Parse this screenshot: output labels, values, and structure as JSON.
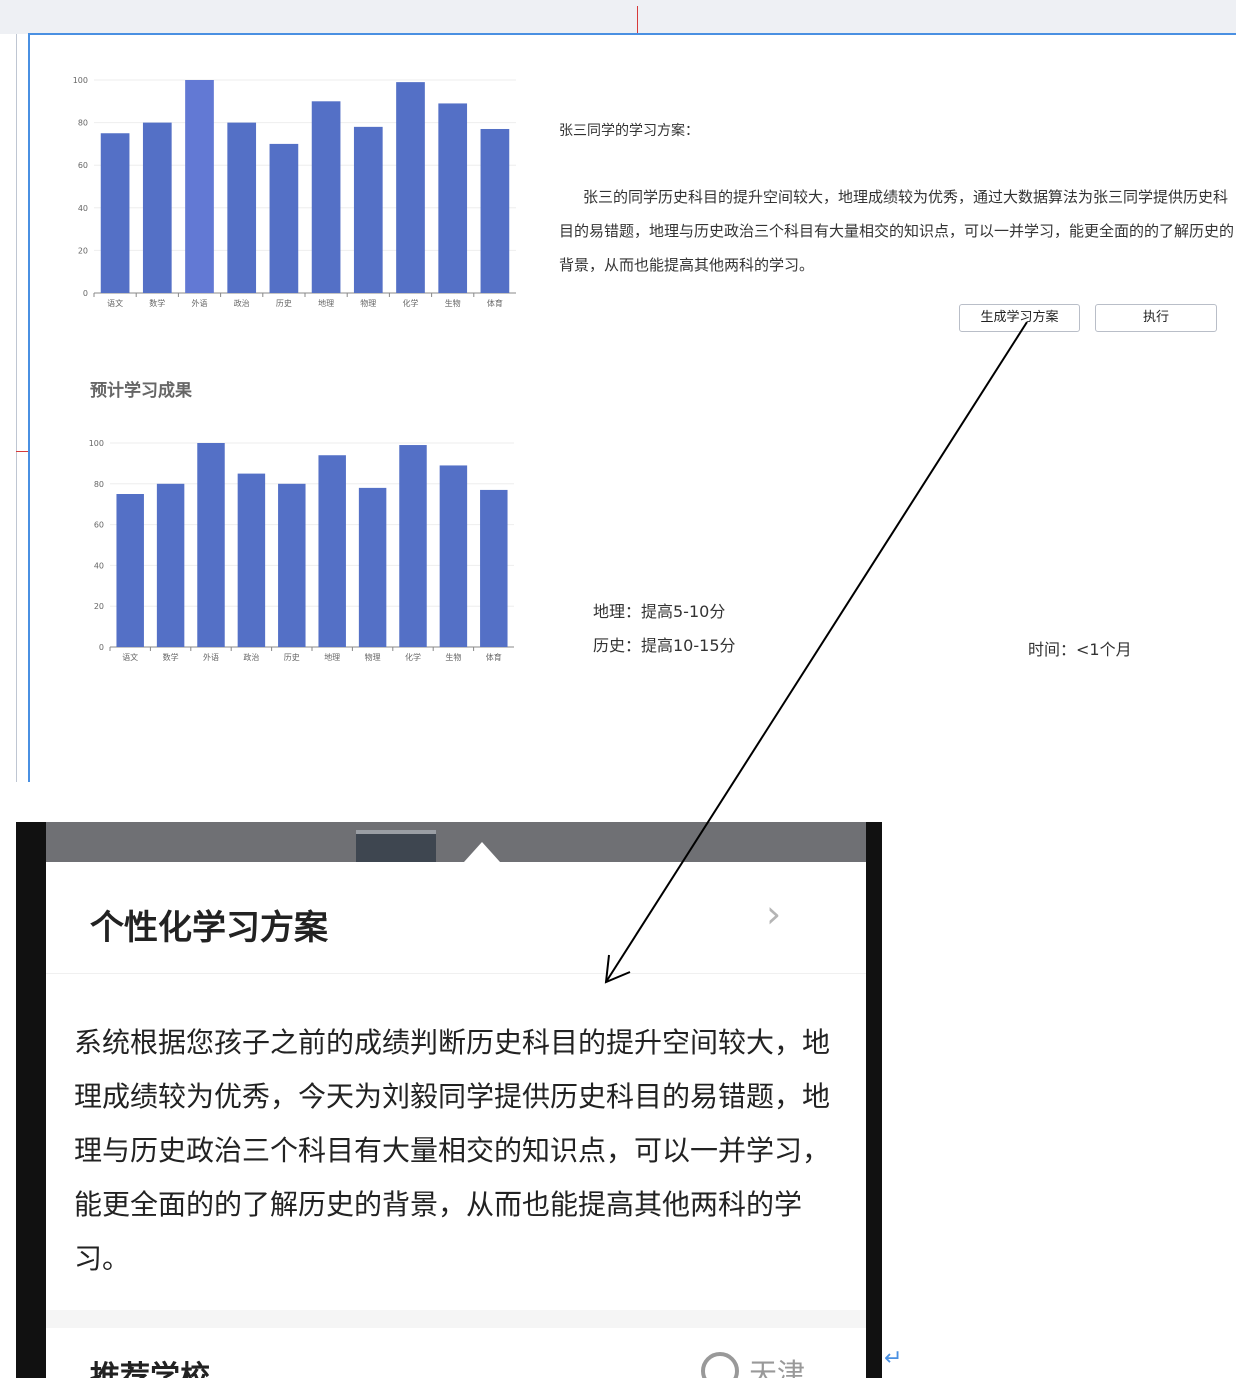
{
  "chart_data": [
    {
      "type": "bar",
      "categories": [
        "语文",
        "数学",
        "外语",
        "政治",
        "历史",
        "地理",
        "物理",
        "化学",
        "生物",
        "体育"
      ],
      "values": [
        75,
        80,
        100,
        80,
        70,
        90,
        78,
        99,
        89,
        77
      ],
      "ylim": [
        0,
        100
      ],
      "yticks": [
        0,
        20,
        40,
        60,
        80,
        100
      ],
      "grid": true,
      "title": "",
      "xlabel": "",
      "ylabel": "",
      "colors": {
        "bar": "#5470c6",
        "highlight": "#6279d4",
        "axis": "#888888",
        "grid": "#eeeeee"
      }
    },
    {
      "type": "bar",
      "categories": [
        "语文",
        "数学",
        "外语",
        "政治",
        "历史",
        "地理",
        "物理",
        "化学",
        "生物",
        "体育"
      ],
      "values": [
        75,
        80,
        100,
        85,
        80,
        94,
        78,
        99,
        89,
        77
      ],
      "ylim": [
        0,
        100
      ],
      "yticks": [
        0,
        20,
        40,
        60,
        80,
        100
      ],
      "grid": true,
      "title": "",
      "xlabel": "",
      "ylabel": "",
      "colors": {
        "bar": "#5470c6",
        "axis": "#888888",
        "grid": "#eeeeee"
      }
    }
  ],
  "plan": {
    "heading": "张三同学的学习方案：",
    "body": "张三的同学历史科目的提升空间较大，地理成绩较为优秀，通过大数据算法为张三同学提供历史科目的易错题，地理与历史政治三个科目有大量相交的知识点，可以一并学习，能更全面的的了解历史的背景，从而也能提高其他两科的学习。",
    "generate_button": "生成学习方案",
    "execute_button": "执行"
  },
  "results": {
    "section_title": "预计学习成果",
    "geography": "地理：提高5-10分",
    "history": "历史：提高10-15分",
    "time": "时间：<1个月"
  },
  "phone": {
    "card_title": "个性化学习方案",
    "chevron_icon": "chevron-right-icon",
    "card_body": "系统根据您孩子之前的成绩判断历史科目的提升空间较大，地理成绩较为优秀，今天为刘毅同学提供历史科目的易错题，地理与历史政治三个科目有大量相交的知识点，可以一并学习，能更全面的的了解历史的背景，从而也能提高其他两科的学习。",
    "next_section": "推荐学校",
    "location_icon": "location-pin-icon",
    "location_text": "天津"
  },
  "annotations": {
    "arrow_icon": "arrow-icon",
    "return_mark": "↵"
  }
}
